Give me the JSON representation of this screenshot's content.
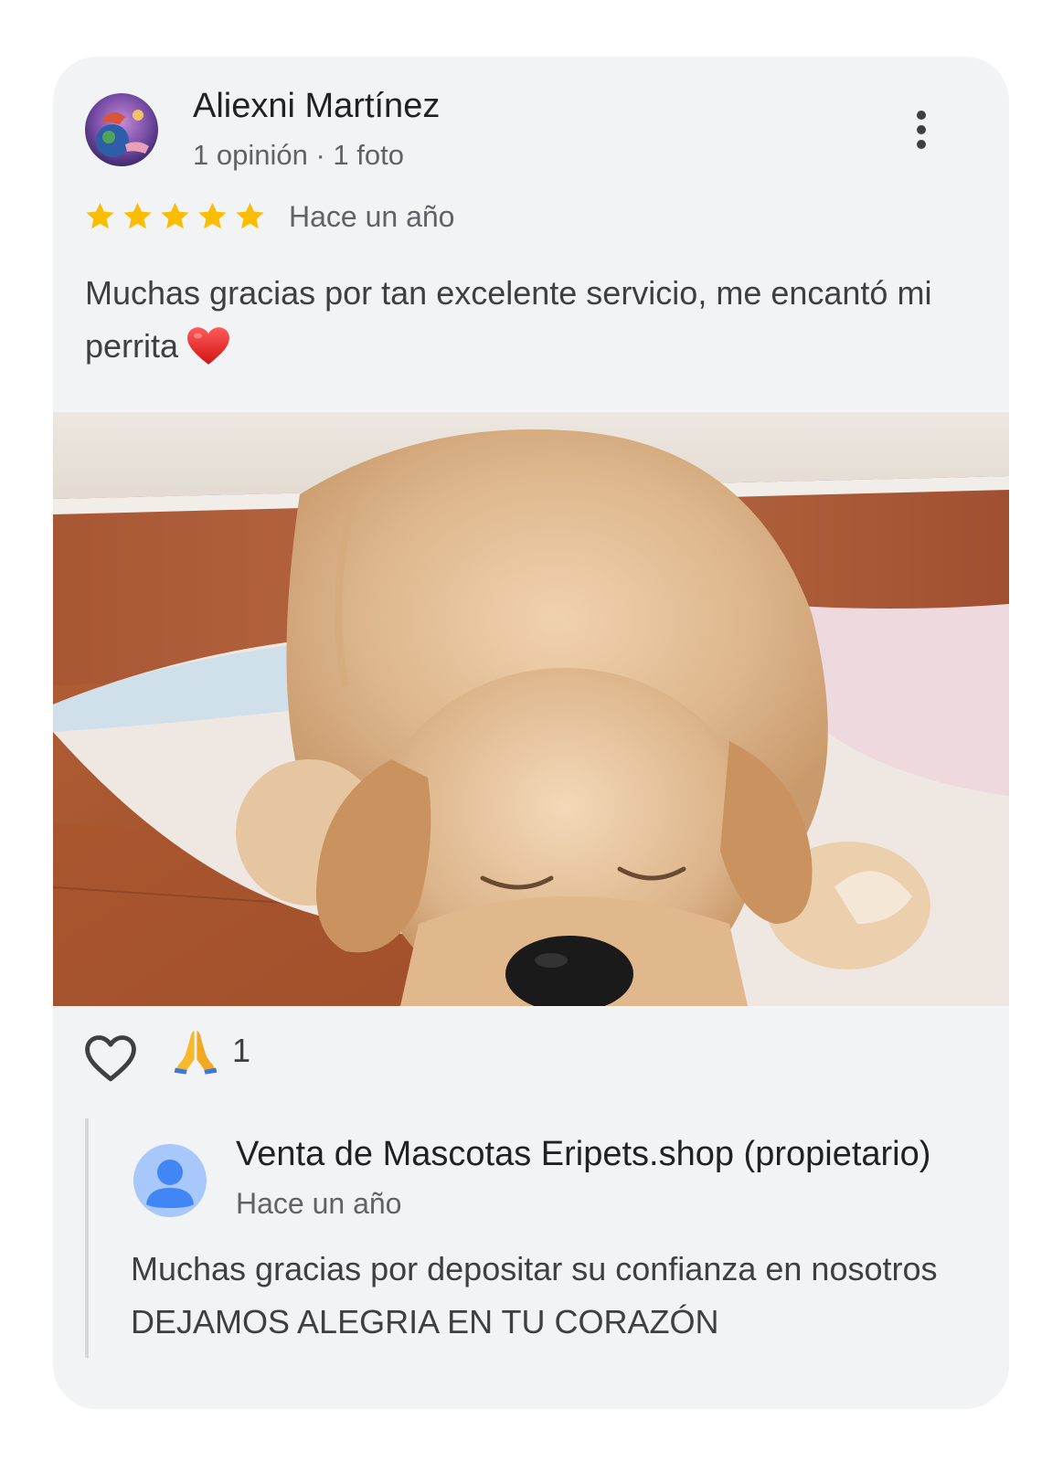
{
  "review": {
    "author_name": "Aliexni Martínez",
    "author_meta": "1 opinión · 1 foto",
    "rating": 5,
    "rating_max": 5,
    "date": "Hace un año",
    "text": "Muchas gracias por tan excelente servicio, me encantó mi perrita",
    "text_emoji": "red-heart-emoji",
    "photo_icon": "puppy-photo",
    "more_icon": "more-vert-icon"
  },
  "reactions": {
    "like_icon": "heart-outline-icon",
    "reaction_icon": "folded-hands-emoji",
    "count": "1"
  },
  "owner_reply": {
    "name": "Venta de Mascotas Eripets.shop (propietario)",
    "date": "Hace un año",
    "text": "Muchas gracias por depositar su confianza en nosotros DEJAMOS ALEGRIA EN TU CORAZÓN",
    "avatar_icon": "person-icon"
  },
  "colors": {
    "card_background": "#f1f3f4",
    "star": "#fbbc04",
    "owner_avatar": "#a8c7fa",
    "owner_avatar_person": "#4285f4"
  }
}
